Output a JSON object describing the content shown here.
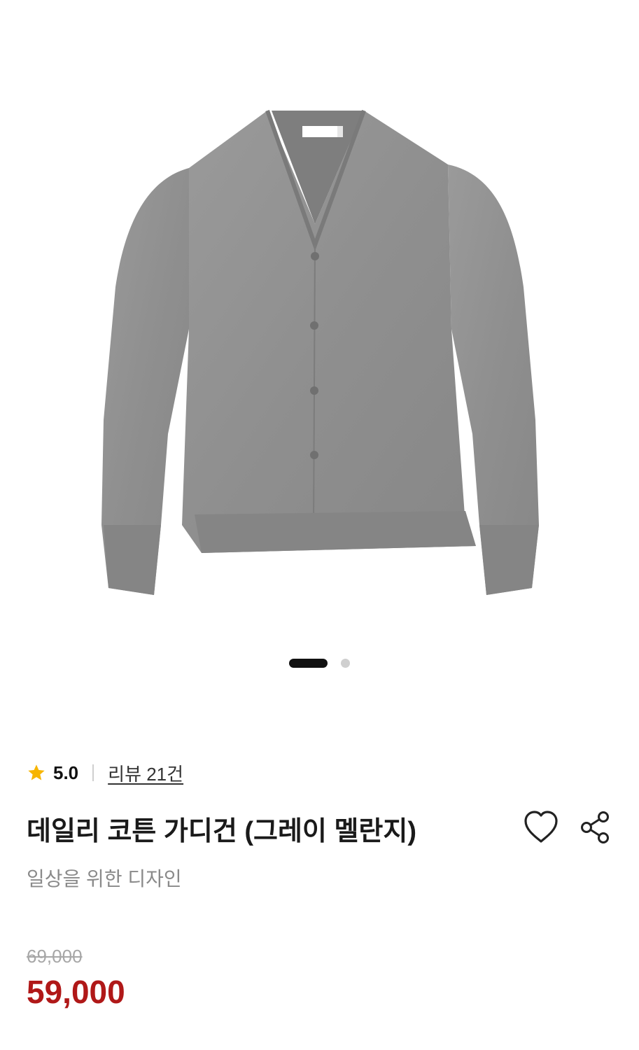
{
  "gallery": {
    "image": "grey-v-neck-cardigan",
    "slide_count": 2,
    "active_slide": 1
  },
  "rating": {
    "score": "5.0",
    "review_link": "리뷰 21건",
    "star_color": "#f7b500"
  },
  "product": {
    "title": "데일리 코튼 가디건 (그레이 멜란지)",
    "subtitle": "일상을 위한 디자인",
    "original_price": "69,000",
    "sale_price": "59,000",
    "sale_color": "#b01818"
  },
  "actions": {
    "wishlist_icon": "heart-icon",
    "share_icon": "share-icon"
  }
}
